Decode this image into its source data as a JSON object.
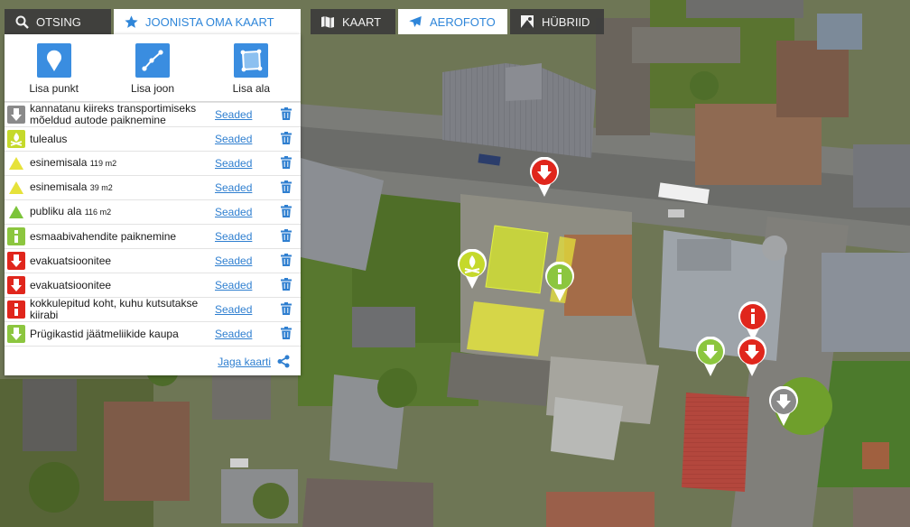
{
  "tabs": [
    {
      "id": "search",
      "label": "Otsing",
      "icon": "search-icon"
    },
    {
      "id": "draw",
      "label": "Joonista oma kaart",
      "icon": "star-icon",
      "active": true
    }
  ],
  "map_types": [
    {
      "id": "map",
      "label": "Kaart",
      "icon": "map-icon"
    },
    {
      "id": "aerial",
      "label": "Aerofoto",
      "icon": "plane-icon",
      "active": true
    },
    {
      "id": "hybrid",
      "label": "Hübriid",
      "icon": "hybrid-icon"
    }
  ],
  "tools": [
    {
      "label": "Lisa punkt",
      "icon": "point-icon"
    },
    {
      "label": "Lisa joon",
      "icon": "line-icon"
    },
    {
      "label": "Lisa ala",
      "icon": "area-icon"
    }
  ],
  "settings_label": "Seaded",
  "items": [
    {
      "label": "kannatanu kiireks transportimiseks mõeldud autode paiknemine",
      "area": "",
      "icon": "arrow-down-icon",
      "color": "#8a8a8a"
    },
    {
      "label": "tulealus",
      "area": "",
      "icon": "fire-icon",
      "color": "#c5d92b"
    },
    {
      "label": "esinemisala",
      "area": "119 m2",
      "icon": "triangle-icon",
      "color": "#e6e23a"
    },
    {
      "label": "esinemisala",
      "area": "39 m2",
      "icon": "triangle-icon",
      "color": "#e6e23a"
    },
    {
      "label": "publiku ala",
      "area": "116 m2",
      "icon": "triangle-icon",
      "color": "#7cc43a"
    },
    {
      "label": "esmaabivahendite paiknemine",
      "area": "",
      "icon": "info-icon",
      "color": "#8cc63f"
    },
    {
      "label": "evakuatsioonitee",
      "area": "",
      "icon": "arrow-down-icon",
      "color": "#e0261c"
    },
    {
      "label": "evakuatsioonitee",
      "area": "",
      "icon": "arrow-down-icon",
      "color": "#e0261c"
    },
    {
      "label": "kokkulepitud koht, kuhu kutsutakse kiirabi",
      "area": "",
      "icon": "info-icon",
      "color": "#e0261c"
    },
    {
      "label": "Prügikastid jäätmeliikide kaupa",
      "area": "",
      "icon": "arrow-down-icon",
      "color": "#8cc63f"
    }
  ],
  "share_label": "Jaga kaarti",
  "colors": {
    "accent": "#3a8de0",
    "link": "#2f7fd0",
    "red": "#e0261c",
    "green": "#8cc63f",
    "gray": "#8a8a8a",
    "yellow": "#e6e23a"
  }
}
